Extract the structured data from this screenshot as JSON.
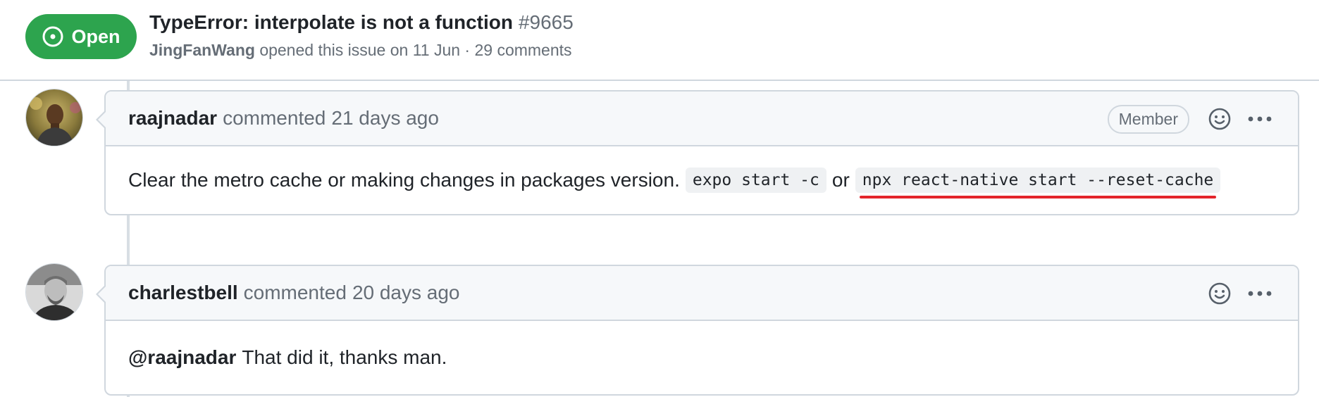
{
  "issue": {
    "state_label": "Open",
    "title": "TypeError: interpolate is not a function",
    "number": "#9665",
    "author": "JingFanWang",
    "meta_text": "opened this issue on 11 Jun · 29 comments"
  },
  "comments": [
    {
      "author": "raajnadar",
      "action": "commented",
      "time": "21 days ago",
      "role_badge": "Member",
      "body": {
        "text": "Clear the metro cache or making changes in packages version.",
        "code1": "expo start -c",
        "connector": "or",
        "code2": "npx react-native start --reset-cache"
      }
    },
    {
      "author": "charlestbell",
      "action": "commented",
      "time": "20 days ago",
      "body": {
        "mention": "@raajnadar",
        "text": "That did it, thanks man."
      }
    }
  ],
  "icons": {
    "state": "issue-opened-icon",
    "reaction": "smiley-icon",
    "menu": "kebab-horizontal-icon"
  },
  "colors": {
    "open_green": "#2da44e",
    "underline_red": "#e3242b",
    "border": "#d0d7de",
    "header_bg": "#f6f8fa"
  }
}
